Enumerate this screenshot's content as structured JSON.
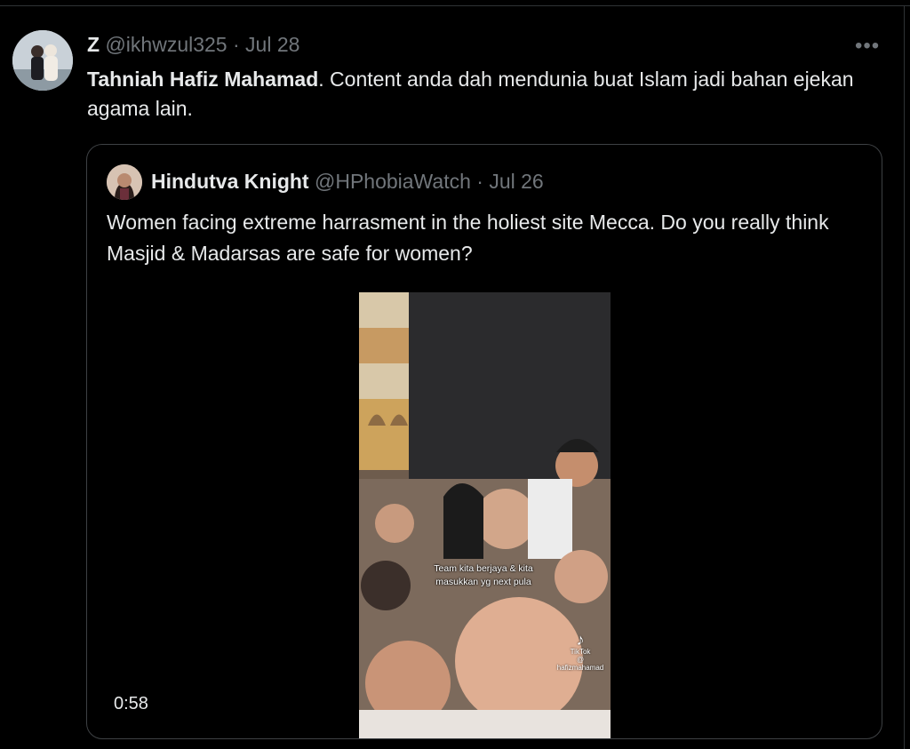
{
  "tweet": {
    "author_name": "Z",
    "handle": "@ikhwzul325",
    "separator": "·",
    "date": "Jul 28",
    "more_label": "•••",
    "text_bold": "Tahniah Hafiz Mahamad",
    "text_rest": ". Content anda dah mendunia buat Islam jadi bahan ejekan agama lain."
  },
  "quote": {
    "author_name": "Hindutva Knight",
    "handle": "@HPhobiaWatch",
    "separator": "·",
    "date": "Jul 26",
    "text": "Women facing extreme harrasment in the holiest site Mecca. Do you really think Masjid & Madarsas are safe for women?",
    "video": {
      "caption_line1": "Team kita berjaya & kita",
      "caption_line2": "masukkan yg next pula",
      "watermark_brand": "TikTok",
      "watermark_handle": "@ hafizmahamad",
      "duration": "0:58"
    }
  },
  "colors": {
    "background": "#000000",
    "text": "#e7e9ea",
    "muted": "#71767b",
    "border": "#3e4144"
  }
}
